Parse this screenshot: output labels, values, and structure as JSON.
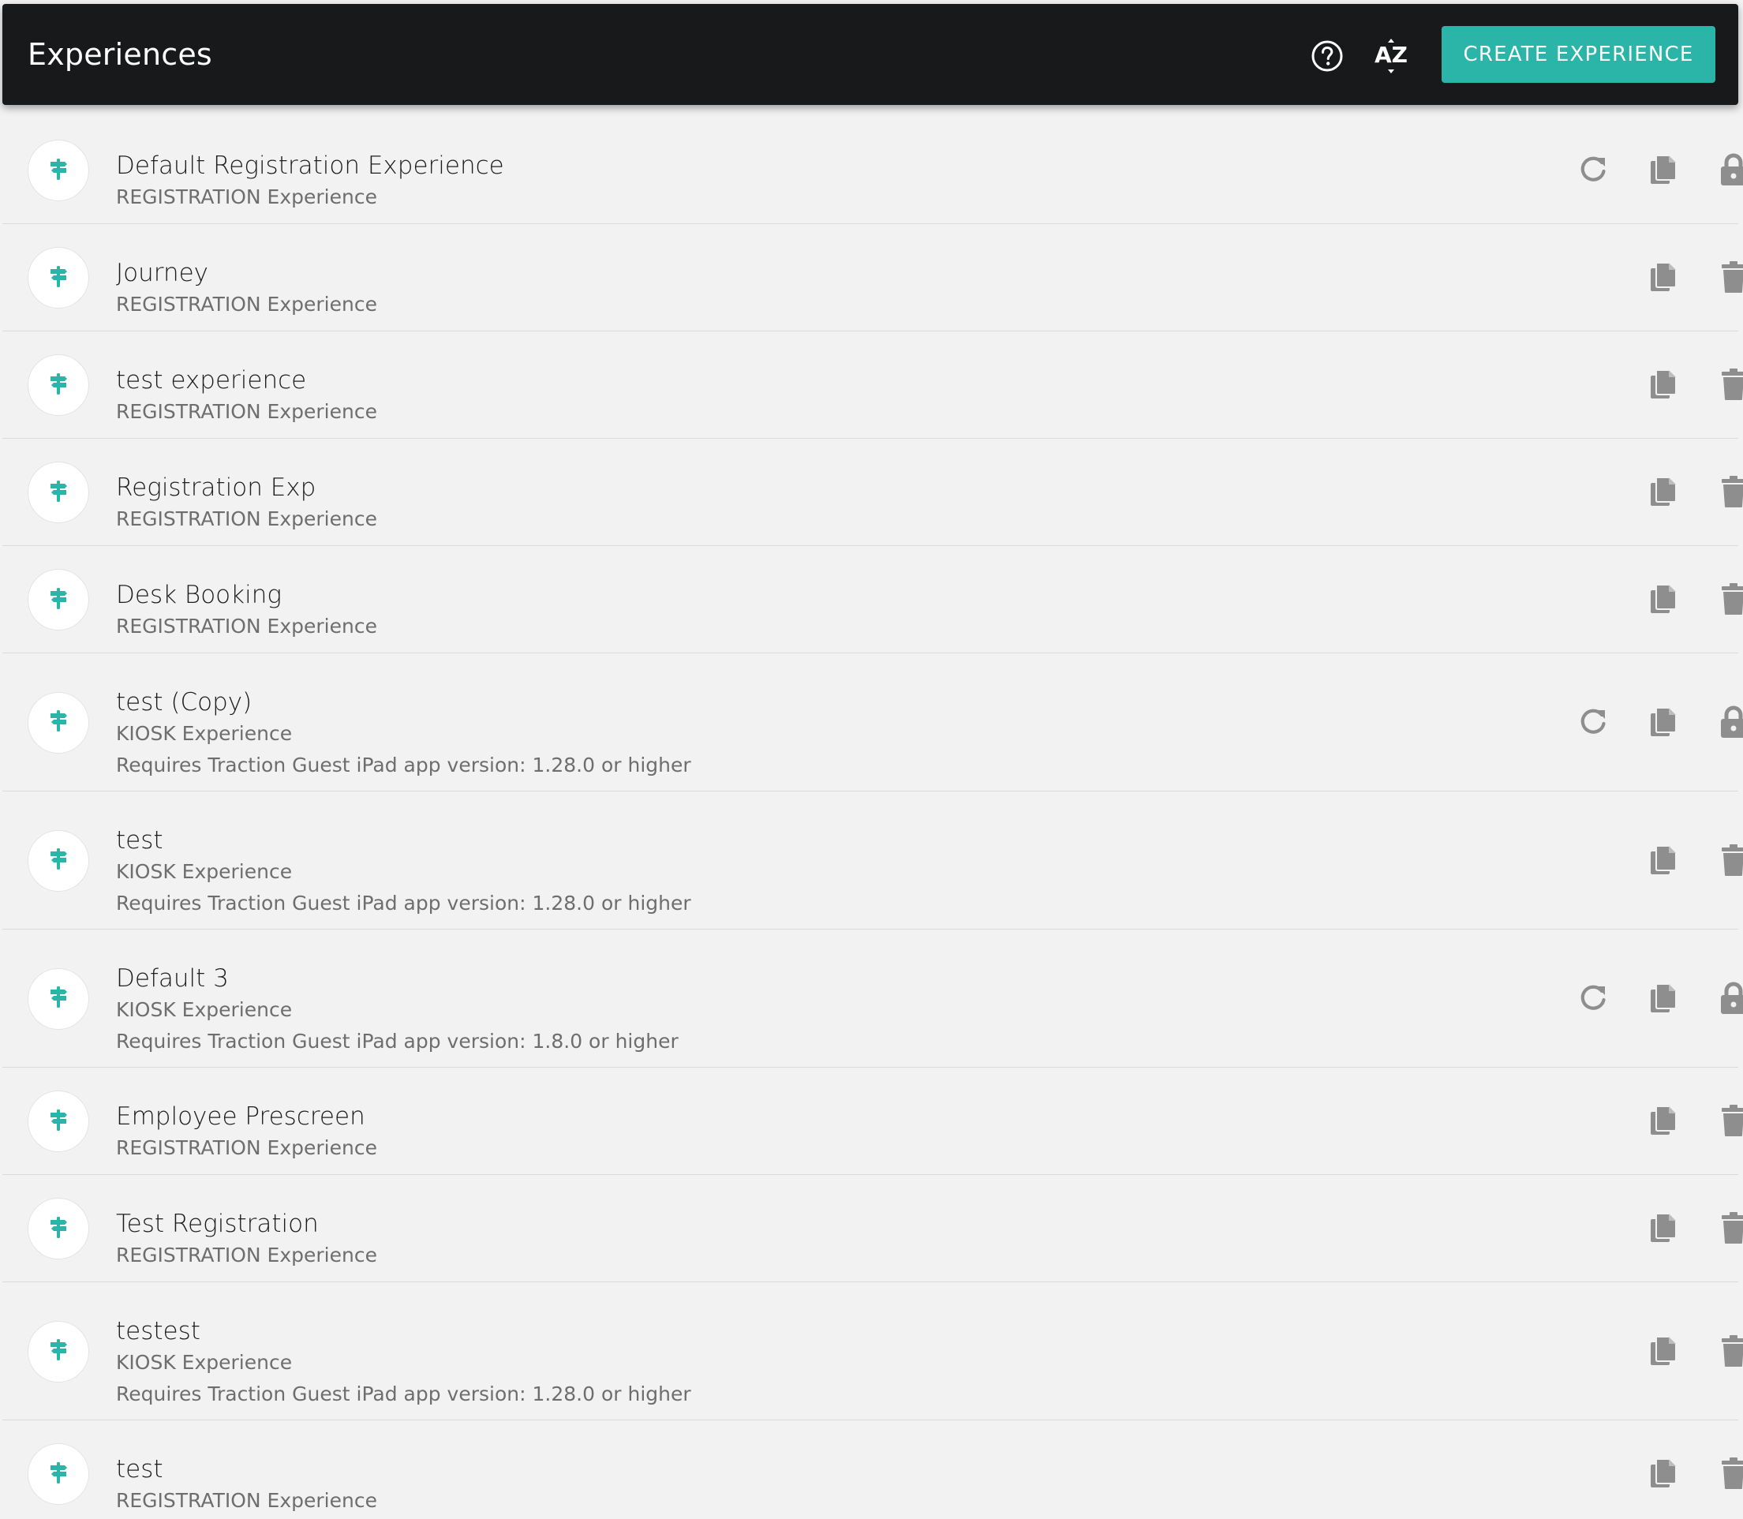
{
  "header": {
    "title": "Experiences",
    "help_icon": "help-circle-icon",
    "sort_icon": "sort-alpha-icon",
    "sort_label": "AZ",
    "create_label": "CREATE EXPERIENCE"
  },
  "colors": {
    "accent": "#2bb5a8",
    "header_bg": "#18191b",
    "page_bg": "#f2f2f2",
    "icon_gray": "#8e8e8e"
  },
  "experiences": [
    {
      "name": "Default Registration Experience",
      "type": "REGISTRATION Experience",
      "requirement": "",
      "actions": [
        "reset",
        "copy",
        "lock"
      ]
    },
    {
      "name": "Journey",
      "type": "REGISTRATION Experience",
      "requirement": "",
      "actions": [
        "copy",
        "delete"
      ]
    },
    {
      "name": "test experience",
      "type": "REGISTRATION Experience",
      "requirement": "",
      "actions": [
        "copy",
        "delete"
      ]
    },
    {
      "name": "Registration Exp",
      "type": "REGISTRATION Experience",
      "requirement": "",
      "actions": [
        "copy",
        "delete"
      ]
    },
    {
      "name": "Desk Booking",
      "type": "REGISTRATION Experience",
      "requirement": "",
      "actions": [
        "copy",
        "delete"
      ]
    },
    {
      "name": "test (Copy)",
      "type": "KIOSK Experience",
      "requirement": "Requires Traction Guest iPad app version: 1.28.0 or higher",
      "actions": [
        "reset",
        "copy",
        "lock"
      ]
    },
    {
      "name": "test",
      "type": "KIOSK Experience",
      "requirement": "Requires Traction Guest iPad app version: 1.28.0 or higher",
      "actions": [
        "copy",
        "delete"
      ]
    },
    {
      "name": "Default 3",
      "type": "KIOSK Experience",
      "requirement": "Requires Traction Guest iPad app version: 1.8.0 or higher",
      "actions": [
        "reset",
        "copy",
        "lock"
      ]
    },
    {
      "name": "Employee Prescreen",
      "type": "REGISTRATION Experience",
      "requirement": "",
      "actions": [
        "copy",
        "delete"
      ]
    },
    {
      "name": "Test Registration",
      "type": "REGISTRATION Experience",
      "requirement": "",
      "actions": [
        "copy",
        "delete"
      ]
    },
    {
      "name": "testest",
      "type": "KIOSK Experience",
      "requirement": "Requires Traction Guest iPad app version: 1.28.0 or higher",
      "actions": [
        "copy",
        "delete"
      ]
    },
    {
      "name": "test",
      "type": "REGISTRATION Experience",
      "requirement": "",
      "actions": [
        "copy",
        "delete"
      ]
    }
  ]
}
